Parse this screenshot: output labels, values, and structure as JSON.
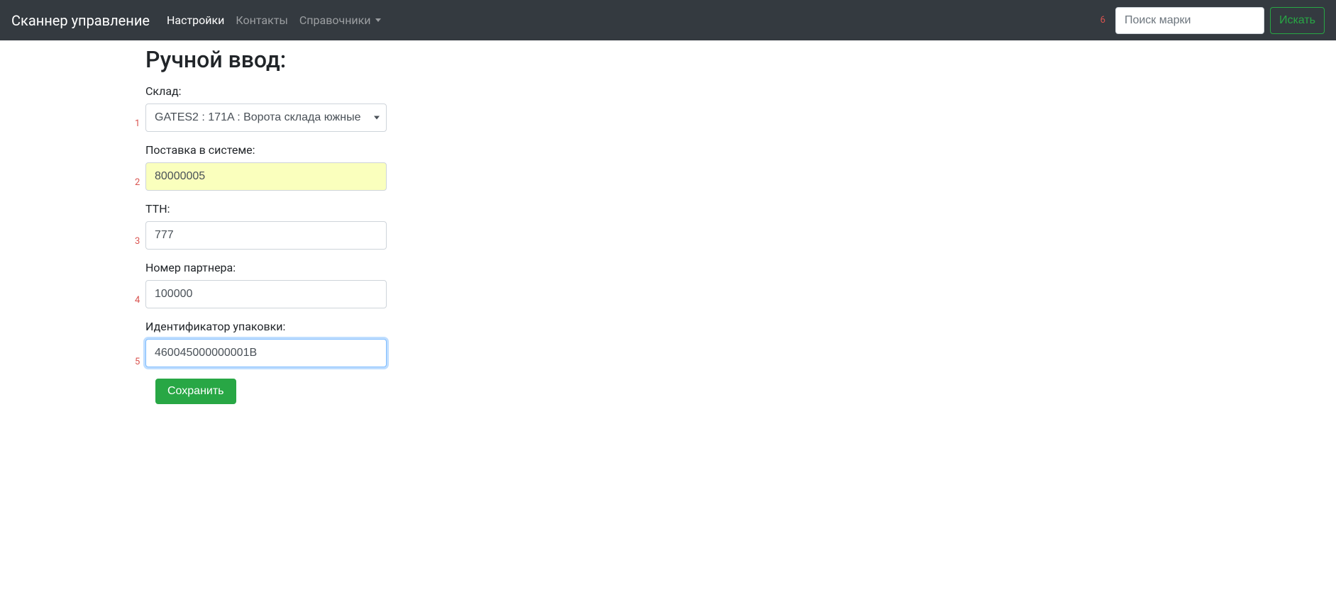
{
  "navbar": {
    "brand": "Сканнер управление",
    "items": [
      {
        "label": "Настройки",
        "active": true
      },
      {
        "label": "Контакты",
        "active": false
      },
      {
        "label": "Справочники",
        "active": false,
        "dropdown": true
      }
    ],
    "search": {
      "placeholder": "Поиск марки",
      "button_label": "Искать",
      "annotation": "6"
    }
  },
  "page": {
    "title": "Ручной ввод:"
  },
  "form": {
    "warehouse": {
      "label": "Склад:",
      "selected": "GATES2 : 171A : Ворота склада южные",
      "annotation": "1"
    },
    "delivery": {
      "label": "Поставка в системе:",
      "value": "80000005",
      "annotation": "2"
    },
    "ttn": {
      "label": "ТТН:",
      "value": "777",
      "annotation": "3"
    },
    "partner": {
      "label": "Номер партнера:",
      "value": "100000",
      "annotation": "4"
    },
    "package": {
      "label": "Идентификатор упаковки:",
      "value": "460045000000001B",
      "annotation": "5"
    },
    "save_label": "Сохранить"
  }
}
